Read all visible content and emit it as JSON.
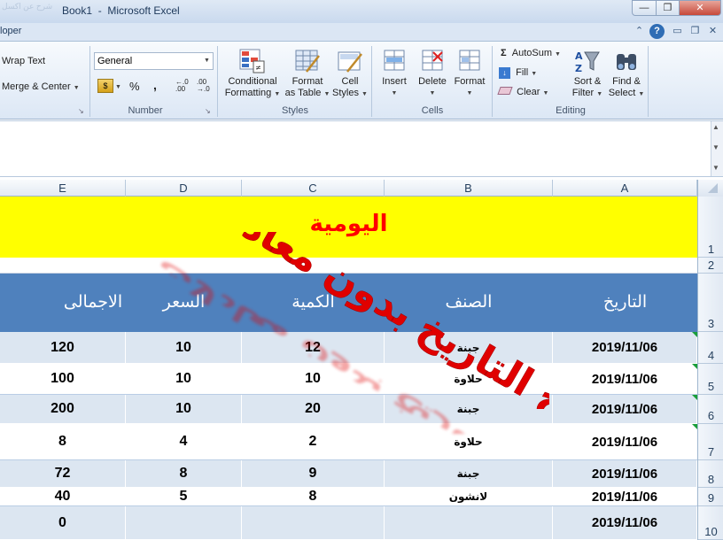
{
  "window": {
    "title": "Book1  -  Microsoft Excel",
    "faded_title": "شرح عن اكسل"
  },
  "tabs": {
    "developer": "loper"
  },
  "ribbon": {
    "alignment": {
      "wrap_text": "Wrap Text",
      "merge_center": "Merge & Center"
    },
    "number": {
      "format": "General",
      "percent": "%",
      "comma": ",",
      "inc_decimal": ".00→.0",
      "dec_decimal": ".00",
      "group": "Number"
    },
    "styles": {
      "conditional": [
        "Conditional",
        "Formatting"
      ],
      "format_table": [
        "Format",
        "as Table"
      ],
      "cell_styles": [
        "Cell",
        "Styles"
      ],
      "group": "Styles"
    },
    "cells": {
      "insert": "Insert",
      "delete": "Delete",
      "format": "Format",
      "group": "Cells"
    },
    "editing": {
      "autosum": "AutoSum",
      "fill": "Fill",
      "clear": "Clear",
      "sort_filter": [
        "Sort &",
        "Filter"
      ],
      "find_select": [
        "Find &",
        "Select"
      ],
      "group": "Editing"
    }
  },
  "grid": {
    "columns": [
      "E",
      "D",
      "C",
      "B",
      "A"
    ],
    "rows": [
      "1",
      "2",
      "3",
      "4",
      "5",
      "6",
      "7",
      "8",
      "9",
      "10"
    ],
    "title": "اليومية",
    "headers": {
      "date": "التاريخ",
      "item": "الصنف",
      "qty": "الكمية",
      "price": "السعر",
      "total": "الاجمالى"
    },
    "data": [
      {
        "date": "2019/11/06",
        "item": "جبنة",
        "qty": "12",
        "price": "10",
        "total": "120"
      },
      {
        "date": "2019/11/06",
        "item": "حلاوة",
        "qty": "10",
        "price": "10",
        "total": "100"
      },
      {
        "date": "2019/11/06",
        "item": "جبنة",
        "qty": "20",
        "price": "10",
        "total": "200"
      },
      {
        "date": "2019/11/06",
        "item": "حلاوة",
        "qty": "2",
        "price": "4",
        "total": "8"
      },
      {
        "date": "2019/11/06",
        "item": "جبنة",
        "qty": "9",
        "price": "8",
        "total": "72"
      },
      {
        "date": "2019/11/06",
        "item": "لانشون",
        "qty": "8",
        "price": "5",
        "total": "40"
      },
      {
        "date": "2019/11/06",
        "item": "",
        "qty": "",
        "price": "",
        "total": "0"
      }
    ]
  },
  "watermark": {
    "line1": "ادراج التاريخ بدون معادلات"
  },
  "colors": {
    "title_fill": "#ffff00",
    "title_text": "#ff0000",
    "header_fill": "#4f81bd",
    "band_fill": "#dce6f1",
    "watermark": "#e00000"
  }
}
